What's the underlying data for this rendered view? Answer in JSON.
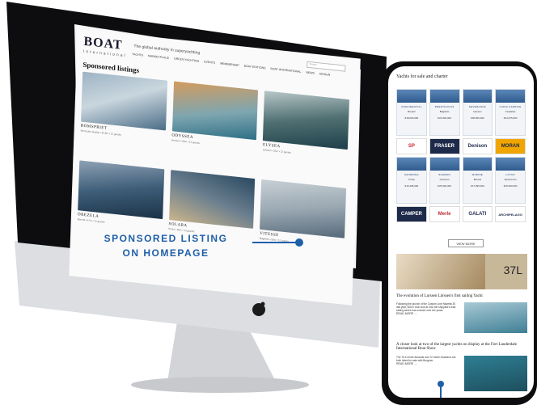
{
  "site": {
    "logo": "BOAT",
    "logo_sub": "International",
    "tagline": "The global authority in superyachting",
    "nav": [
      "YACHTS",
      "MARKETPLACE",
      "GREEN YACHTING",
      "EVENTS",
      "MEMBERSHIP",
      "BOAT EDITIONS",
      "BOAT INTERNATIONAL",
      "NEWS",
      "DESIGN"
    ],
    "search_placeholder": "Search"
  },
  "desktop": {
    "section_title": "Sponsored listings",
    "cards": [
      {
        "name": "BOMSPRIET",
        "meta": "Mercedes Quality • 54.8m • 12 guests",
        "img": "linear-gradient(160deg,#9db3c4 0%,#c9d6de 45%,#4a6c86 100%)"
      },
      {
        "name": "ODYSSEA",
        "meta": "Heesen • 50m • 12 guests",
        "img": "linear-gradient(170deg,#d39b5e 0%,#7ea6b0 55%,#2e6f86 100%)"
      },
      {
        "name": "ELYSEA",
        "meta": "Lürssen • 51m • 12 guests",
        "img": "linear-gradient(170deg,#b8c7c9 0%,#4f6f71 50%,#1e3f4a 100%)"
      },
      {
        "name": "DREZELA",
        "meta": "Benetti • 47m • 12 guests",
        "img": "linear-gradient(170deg,#8fa2b5 0%,#3d5d78 50%,#1b3246 100%)"
      },
      {
        "name": "SOLARA",
        "meta": "Perini • 56m • 12 guests",
        "img": "linear-gradient(200deg,#2b4a62 0%,#6b7f8f 50%,#c9b48b 100%)"
      },
      {
        "name": "VITESSE",
        "meta": "Baglietto • 50m • 12 guests",
        "img": "linear-gradient(170deg,#c8d0d5 0%,#9aa8b2 50%,#56697a 100%)"
      }
    ]
  },
  "phone": {
    "heading": "Yachts for sale and charter",
    "tiles": [
      {
        "name": "CONFIDENTIAL",
        "len": "Benetti",
        "price": "€18,000,000"
      },
      {
        "name": "PRESTIGIOUS",
        "len": "Baglietto",
        "price": "€24,900,000"
      },
      {
        "name": "SEVERANCE",
        "len": "Heesen",
        "price": "€38,900,000"
      },
      {
        "name": "ILONA CAPRICE",
        "len": "Feadship",
        "price": "€14,975,000"
      }
    ],
    "logos_row1": [
      "SP",
      "FRASER",
      "Denison",
      "MORAN"
    ],
    "tiles2": [
      {
        "name": "SANDRINA",
        "len": "Trinity",
        "price": "€15,495,000"
      },
      {
        "name": "SHAMAN",
        "len": "Oceanco",
        "price": "€25,900,000"
      },
      {
        "name": "MARINE",
        "len": "Benetti",
        "price": "€17,995,000"
      },
      {
        "name": "LOTUS",
        "len": "Sanlorenzo",
        "price": "€19,900,000"
      }
    ],
    "logos_row2": [
      "CAMPER",
      "Merle",
      "GALATI",
      "ARCHIPELAGO"
    ],
    "view_more": "VIEW MORE",
    "ad_number": "37L",
    "article1_title": "The evolution of Lurssen Lürssen's first sailing Yacht",
    "article1_body": "Following the launch of the Custom Line Navetta 30 last year, BOAT took look at how the shipyard's lead sailing series has evolved over the years.",
    "article2_title": "A closer look at two of the largest yachts on display at the Fort Lauderdale International Boat Show",
    "article2_body": "The 76.4 metre Amanda and 72 metre Amadeus are both listed for sale with Burgess.",
    "read_more": "READ MORE →"
  },
  "callout": {
    "line1": "SPONSORED LISTING",
    "line2": "ON HOMEPAGE"
  },
  "colors": {
    "accent_blue": "#1f5fa8",
    "monitor_silver": "#d9dbde",
    "bezel": "#0d0d10"
  }
}
